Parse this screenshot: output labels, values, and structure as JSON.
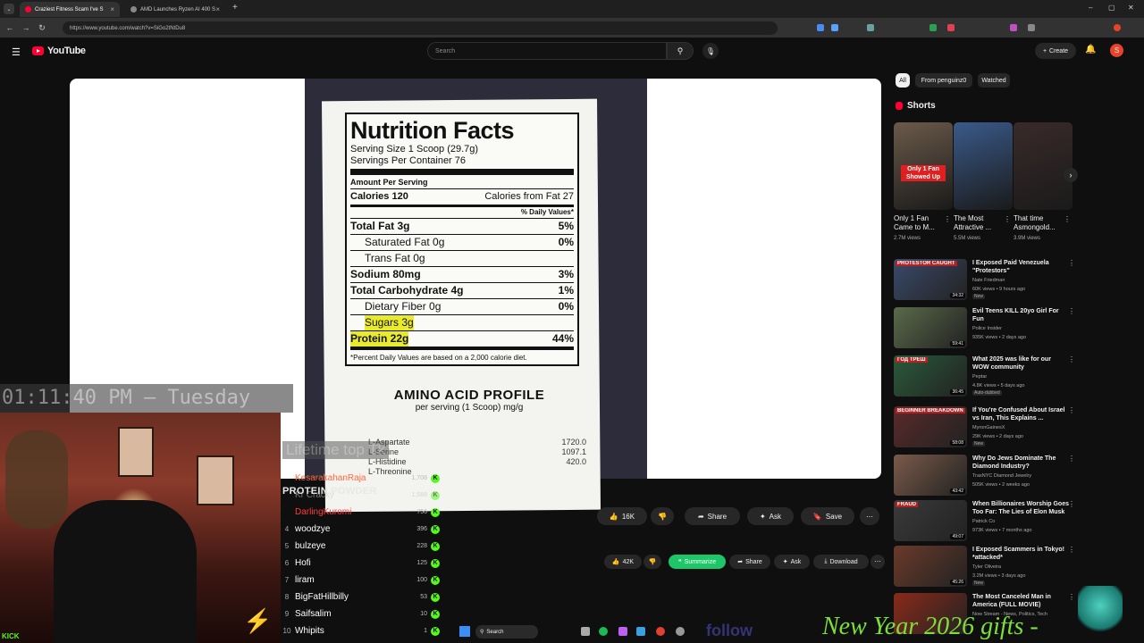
{
  "browser": {
    "tabs": [
      {
        "title": "Craziest Fitness Scam I've S",
        "active": true
      },
      {
        "title": "AMD Launches Ryzen AI 400 S",
        "active": false
      }
    ],
    "url": "https://www.youtube.com/watch?v=SiGo2tNtDu8"
  },
  "youtube": {
    "logo_text": "YouTube",
    "search_placeholder": "Search",
    "create_label": "Create",
    "avatar_letter": "S"
  },
  "video": {
    "label": {
      "title": "Nutrition Facts",
      "serving_size": "Serving Size 1 Scoop (29.7g)",
      "servings_per_container": "Servings Per Container 76",
      "amount_per_serving": "Amount Per Serving",
      "calories": "Calories 120",
      "calories_from_fat": "Calories from Fat 27",
      "daily_value_header": "% Daily Values*",
      "rows": [
        {
          "name": "Total Fat 3g",
          "dv": "5%",
          "indent": false,
          "highlight": false
        },
        {
          "name": "Saturated Fat 0g",
          "dv": "0%",
          "indent": true,
          "highlight": false
        },
        {
          "name": "Trans Fat 0g",
          "dv": "",
          "indent": true,
          "highlight": false
        },
        {
          "name": "Sodium 80mg",
          "dv": "3%",
          "indent": false,
          "highlight": false
        },
        {
          "name": "Total Carbohydrate 4g",
          "dv": "1%",
          "indent": false,
          "highlight": false
        },
        {
          "name": "Dietary Fiber 0g",
          "dv": "0%",
          "indent": true,
          "highlight": false
        },
        {
          "name": "Sugars 3g",
          "dv": "",
          "indent": true,
          "highlight": true
        },
        {
          "name": "Protein 22g",
          "dv": "44%",
          "indent": false,
          "highlight": true
        }
      ],
      "footnote": "*Percent Daily Values are based on a 2,000 calorie diet.",
      "amino_title": "AMINO ACID PROFILE",
      "amino_sub": "per serving (1 Scoop) mg/g",
      "amino_rows": [
        {
          "name": "L-Aspartate",
          "value": "1720.0"
        },
        {
          "name": "L-Serine",
          "value": "1097.1"
        },
        {
          "name": "L-Histidine",
          "value": "420.0"
        },
        {
          "name": "L-Threonine",
          "value": ""
        }
      ]
    },
    "actions": {
      "likes": "16K",
      "share": "Share",
      "ask": "Ask",
      "save": "Save"
    },
    "actions2": {
      "likes": "42K",
      "summarize": "Summarize",
      "share": "Share",
      "ask": "Ask",
      "download": "Download"
    }
  },
  "stream_overlay": {
    "clock": "01:11:40 PM — Tuesday",
    "ghost_text": "Lifetime top Tk",
    "promo": "PROTEIN POWDER",
    "leaderboard": [
      {
        "rank": "",
        "name": "KesarakahanRaja",
        "points": "1,708",
        "color": "#ff6a3d"
      },
      {
        "rank": "",
        "name": "Kr Cracky",
        "points": "1,588",
        "color": "#cccccc"
      },
      {
        "rank": "",
        "name": "DarlingKuromi",
        "points": "756",
        "color": "#ff3b3b"
      },
      {
        "rank": "4",
        "name": "woodzye",
        "points": "396",
        "color": "#ffffff"
      },
      {
        "rank": "5",
        "name": "bulzeye",
        "points": "228",
        "color": "#ffffff"
      },
      {
        "rank": "6",
        "name": "Hofi",
        "points": "125",
        "color": "#ffffff"
      },
      {
        "rank": "7",
        "name": "liram",
        "points": "100",
        "color": "#ffffff"
      },
      {
        "rank": "8",
        "name": "BigFatHillbilly",
        "points": "53",
        "color": "#ffffff"
      },
      {
        "rank": "9",
        "name": "Saifsalim",
        "points": "10",
        "color": "#ffffff"
      },
      {
        "rank": "10",
        "name": "Whipits",
        "points": "1",
        "color": "#ffffff"
      }
    ],
    "kick_label": "KICK",
    "new_year": "New Year 2026 gifts -"
  },
  "sidebar": {
    "chips": [
      "All",
      "From penguinz0",
      "Watched"
    ],
    "shorts_title": "Shorts",
    "shorts": [
      {
        "title": "Only 1 Fan Came to M...",
        "views": "2.7M views",
        "overlay": "Only 1 Fan Showed Up",
        "color": "#6b5a4a"
      },
      {
        "title": "The Most Attractive ...",
        "views": "5.5M views",
        "overlay": "",
        "color": "#3a5a8a"
      },
      {
        "title": "That time Asmongold...",
        "views": "3.9M views",
        "overlay": "",
        "color": "#3a2a2a"
      }
    ],
    "videos": [
      {
        "title": "I Exposed Paid Venezuela \"Protestors\"",
        "channel": "Nate Friedman",
        "meta": "60K views • 9 hours ago",
        "duration": "34:32",
        "new": true,
        "color": "#3a4a6a",
        "badge": "PROTESTOR CAUGHT"
      },
      {
        "title": "Evil Teens KILL 20yo Girl For Fun",
        "channel": "Police Insider",
        "meta": "935K views • 2 days ago",
        "duration": "59:41",
        "new": false,
        "color": "#5a6a4a",
        "badge": ""
      },
      {
        "title": "What 2025 was like for our WOW community",
        "channel": "Peptar",
        "meta": "4.8K views • 5 days ago",
        "duration": "36:45",
        "new": false,
        "color": "#2a5a3a",
        "badge": "ГОД ТРЕШ",
        "extra": "Auto-dubbed"
      },
      {
        "title": "If You're Confused About Israel vs Iran, This Explains ...",
        "channel": "MyronGainesX",
        "meta": "29K views • 2 days ago",
        "duration": "58:08",
        "new": true,
        "color": "#5a2a2a",
        "badge": "BEGINNER BREAKDOWN"
      },
      {
        "title": "Why Do Jews Dominate The Diamond Industry?",
        "channel": "TraxNYC Diamond Jewelry",
        "meta": "505K views • 2 weeks ago",
        "duration": "43:42",
        "new": false,
        "color": "#7a5a4a",
        "badge": ""
      },
      {
        "title": "When Billionaires Worship Goes Too Far: The Lies of Elon Musk",
        "channel": "Patrick Co",
        "meta": "973K views • 7 months ago",
        "duration": "49:07",
        "new": false,
        "color": "#3a3a3a",
        "badge": "FRAUD"
      },
      {
        "title": "I Exposed Scammers in Tokyo! *attacked*",
        "channel": "Tyler Oliveira",
        "meta": "3.2M views • 3 days ago",
        "duration": "45:26",
        "new": true,
        "color": "#6a3a2a",
        "badge": ""
      },
      {
        "title": "The Most Canceled Man in America (FULL MOVIE)",
        "channel": "Now Stream - News, Politics, Tech",
        "meta": "",
        "duration": "",
        "new": false,
        "color": "#8a2a1a",
        "badge": ""
      }
    ]
  },
  "taskbar": {
    "search": "Search",
    "follow_text": "follow"
  },
  "colors": {
    "accent": "#ff0033",
    "kick_green": "#53fc18",
    "summarize_green": "#1ec66a",
    "highlight_yellow": "#e9ea2c"
  }
}
